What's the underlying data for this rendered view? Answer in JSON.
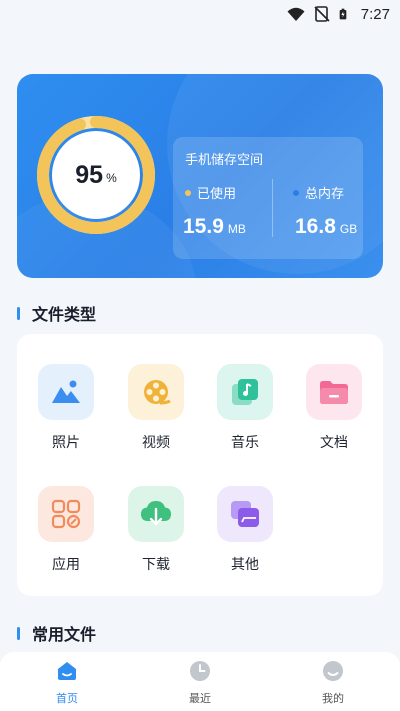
{
  "status_bar": {
    "time": "7:27"
  },
  "storage": {
    "percent_value": "95",
    "percent_unit": "%",
    "percent_fraction": 0.95,
    "title": "手机储存空间",
    "used_label": "已使用",
    "total_label": "总内存",
    "used_value": "15.9",
    "used_unit": "MB",
    "total_value": "16.8",
    "total_unit": "GB",
    "colors": {
      "card": "#2f8ef0",
      "ring": "#f2c45a",
      "ring_track": "#fbe2a2",
      "used_dot": "#f2c45a",
      "total_dot": "#2a7fe6"
    }
  },
  "sections": {
    "file_types": "文件类型",
    "common_files": "常用文件"
  },
  "file_types": [
    {
      "label": "照片",
      "icon": "photo-icon",
      "bg": "#e5f0fd",
      "fg": "#3b8ef0"
    },
    {
      "label": "视频",
      "icon": "video-reel-icon",
      "bg": "#fdf1da",
      "fg": "#f0b33a"
    },
    {
      "label": "音乐",
      "icon": "music-icon",
      "bg": "#dcf6ef",
      "fg": "#2fc29a"
    },
    {
      "label": "文档",
      "icon": "folder-icon",
      "bg": "#fde6ee",
      "fg": "#f26a93"
    },
    {
      "label": "应用",
      "icon": "apps-grid-icon",
      "bg": "#fde8df",
      "fg": "#f28b5c"
    },
    {
      "label": "下载",
      "icon": "cloud-download-icon",
      "bg": "#ddf5e8",
      "fg": "#3fc07e"
    },
    {
      "label": "其他",
      "icon": "stack-icon",
      "bg": "#efe7fb",
      "fg": "#8d5bea"
    }
  ],
  "bottom_nav": [
    {
      "label": "首页",
      "icon": "home-icon",
      "active": true
    },
    {
      "label": "最近",
      "icon": "clock-icon",
      "active": false
    },
    {
      "label": "我的",
      "icon": "profile-icon",
      "active": false
    }
  ]
}
